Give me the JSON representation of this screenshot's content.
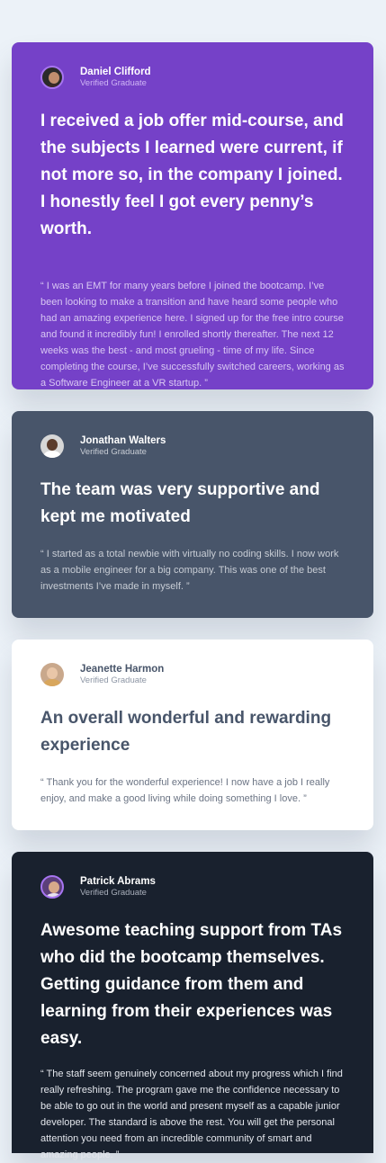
{
  "colors": {
    "page_background": "#ecf2f8",
    "moderate_violet": "#7541c8",
    "grayish_blue": "#48556a",
    "white": "#ffffff",
    "very_dark_blackish_blue": "#19212e",
    "light_violet": "#a775f1"
  },
  "testimonials": [
    {
      "name": "Daniel Clifford",
      "role": "Verified Graduate",
      "avatar_icon": "avatar-daniel",
      "headline": "I received a job offer mid-course, and the subjects I learned were current, if not more so, in the company I joined. I honestly feel I got every penny’s worth.",
      "quote": "“ I was an EMT for many years before I joined the bootcamp. I’ve been looking to make a transition and have heard some people who had an amazing experience here. I signed up for the free intro course and found it incredibly fun! I enrolled shortly thereafter. The next 12 weeks was the best - and most grueling - time of my life. Since completing the course, I’ve successfully switched careers, working as a Software Engineer at a VR startup. ”"
    },
    {
      "name": "Jonathan Walters",
      "role": "Verified Graduate",
      "avatar_icon": "avatar-jonathan",
      "headline": "The team was very supportive and kept me motivated",
      "quote": "“ I started as a total newbie with virtually no coding skills. I now work as a mobile engineer for a big company. This was one of the best investments I’ve made in myself. ”"
    },
    {
      "name": "Jeanette Harmon",
      "role": "Verified Graduate",
      "avatar_icon": "avatar-jeanette",
      "headline": "An overall wonderful and rewarding experience",
      "quote": "“ Thank you for the wonderful experience! I now have a job I really enjoy, and make a good living while doing something I love. ”"
    },
    {
      "name": "Patrick Abrams",
      "role": "Verified Graduate",
      "avatar_icon": "avatar-patrick",
      "headline": "Awesome teaching support from TAs who did the bootcamp themselves. Getting guidance from them and learning from their experiences was easy.",
      "quote": "“ The staff seem genuinely concerned about my progress which I find really refreshing. The program gave me the confidence necessary to be able to go out in the world and present myself as a capable junior developer. The standard is above the rest. You will get the personal attention you need from an incredible community of smart and amazing people. ”"
    }
  ]
}
